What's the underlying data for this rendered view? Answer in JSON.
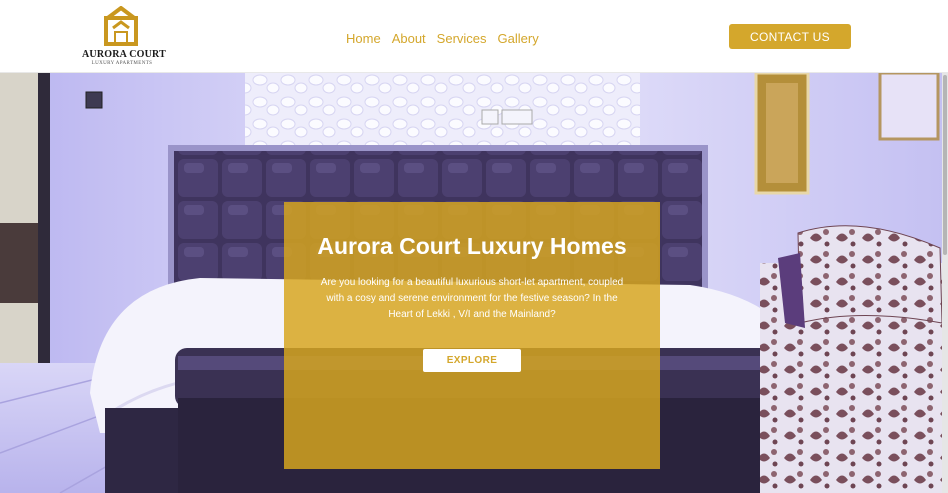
{
  "brand": {
    "name": "AURORA COURT",
    "tagline": "LUXURY APARTMENTS",
    "accent_color": "#d4a72c"
  },
  "nav": {
    "items": [
      {
        "label": "Home"
      },
      {
        "label": "About"
      },
      {
        "label": "Services"
      },
      {
        "label": "Gallery"
      }
    ]
  },
  "header": {
    "contact_label": "CONTACT US"
  },
  "hero": {
    "title": "Aurora Court Luxury Homes",
    "description": "Are you looking for a beautiful luxurious short-let apartment, coupled with a cosy and serene environment for the festive season? In the Heart of Lekki , V/I and the Mainland?",
    "cta_label": "EXPLORE",
    "image_subject": "bedroom-photo"
  }
}
